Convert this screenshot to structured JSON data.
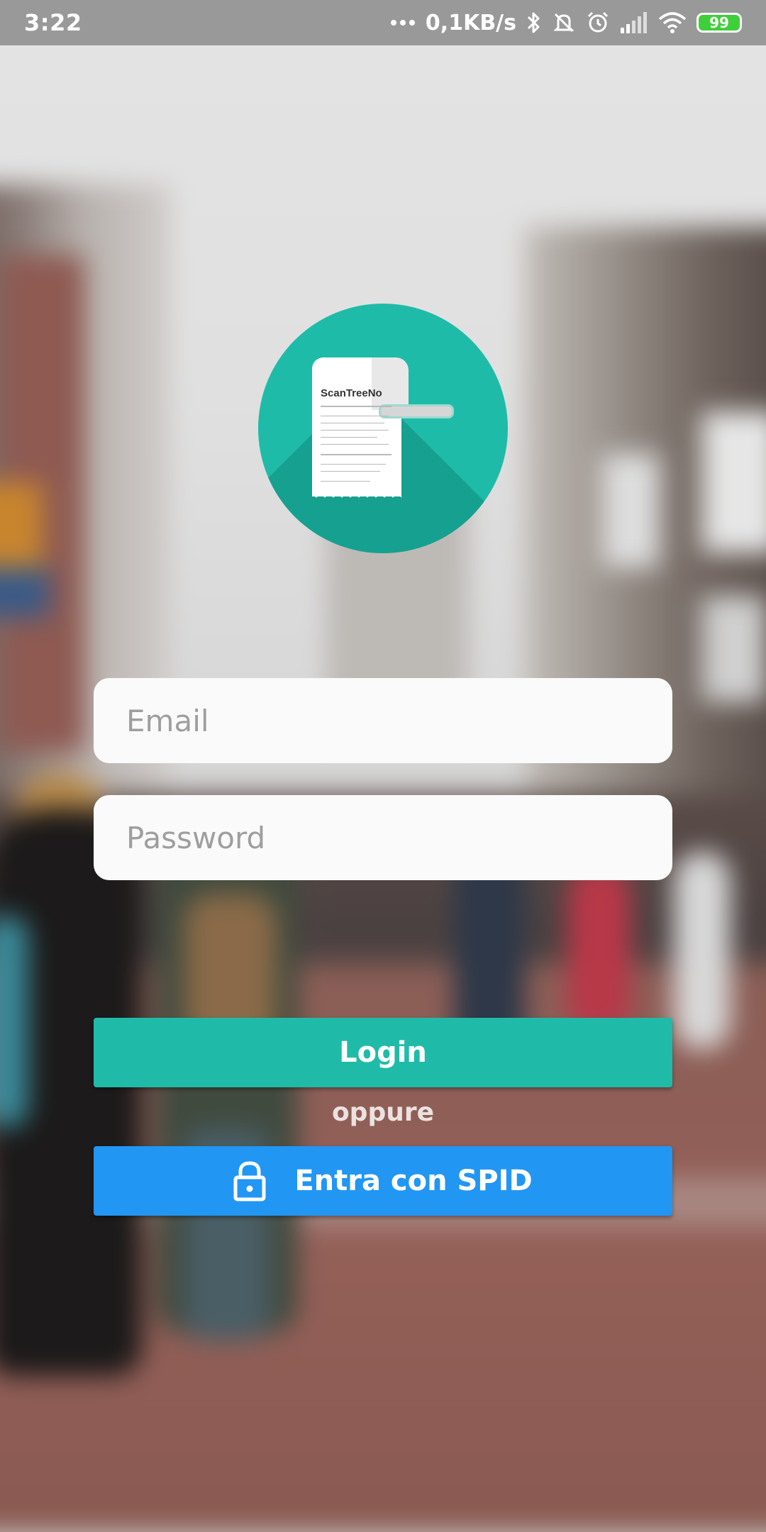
{
  "status_bar": {
    "time": "3:22",
    "network_speed": "0,1KB/s",
    "battery": "99",
    "icons": [
      "more-dots-icon",
      "bluetooth-icon",
      "mute-icon",
      "alarm-icon",
      "signal-icon",
      "wifi-icon",
      "battery-icon"
    ]
  },
  "logo": {
    "title": "ScanTreeNo",
    "icon": "receipt-icon",
    "color": "#1fbba9"
  },
  "login_form": {
    "email_placeholder": "Email",
    "password_placeholder": "Password",
    "login_label": "Login",
    "separator": "oppure",
    "spid_label": "Entra con SPID",
    "spid_icon": "lock-icon"
  },
  "colors": {
    "login_button": "#20bba8",
    "spid_button": "#2296f3"
  }
}
